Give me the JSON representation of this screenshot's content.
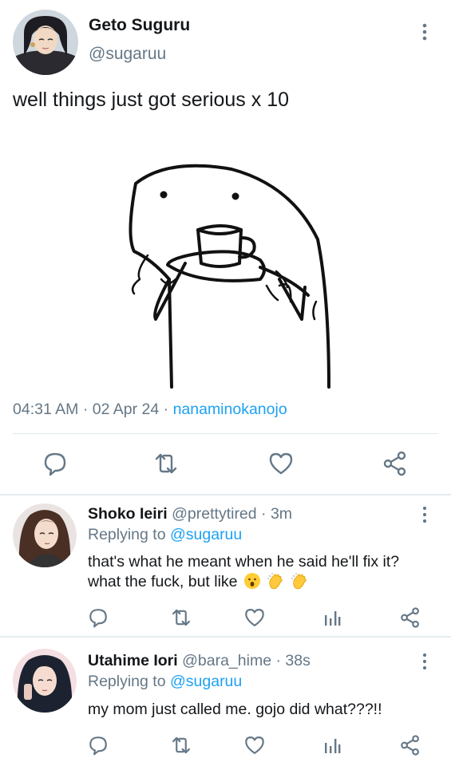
{
  "main_tweet": {
    "author_name": "Geto Suguru",
    "author_handle": "@sugaruu",
    "text": "well things just got serious x 10",
    "time": "04:31 AM",
    "date": "02 Apr 24",
    "source": "nanaminokanojo",
    "image_description_icon": "sipping-tea-meme-drawing",
    "actions": [
      "reply-icon",
      "retweet-icon",
      "like-icon",
      "share-icon"
    ]
  },
  "replies": [
    {
      "author_name": "Shoko Ieiri",
      "author_handle": "@prettytired",
      "time": "· 3m",
      "replying_prefix": "Replying to",
      "replying_to": "@sugaruu",
      "text": "that's what he meant when he said he'll fix it? what the fuck, but like",
      "emojis": [
        "hushed-face-emoji",
        "clapping-hands-emoji",
        "clapping-hands-emoji"
      ]
    },
    {
      "author_name": "Utahime Iori",
      "author_handle": "@bara_hime",
      "time": "· 38s",
      "replying_prefix": "Replying to",
      "replying_to": "@sugaruu",
      "text": "my mom just called me. gojo did what???!!"
    }
  ],
  "colors": {
    "text": "#14171a",
    "secondary": "#657786",
    "accent": "#1da1f2",
    "divider": "#e6ecf0"
  }
}
